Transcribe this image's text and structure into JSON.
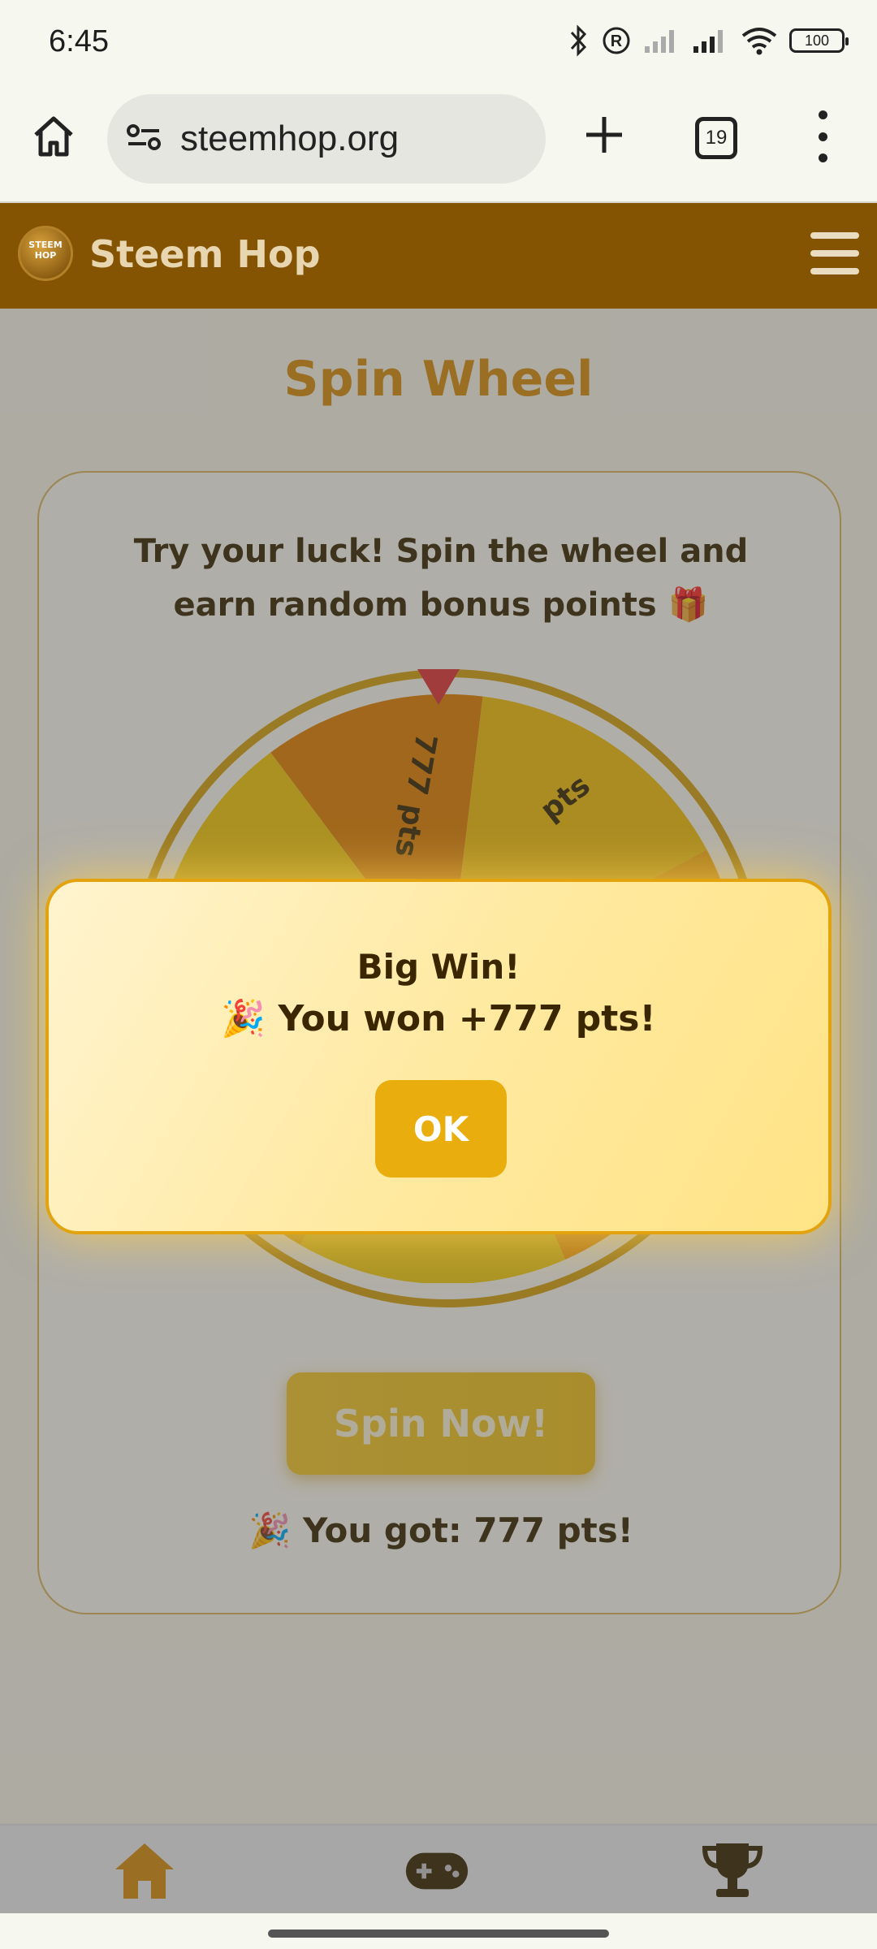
{
  "status_bar": {
    "time": "6:45",
    "battery": "100",
    "icons": [
      "bluetooth-icon",
      "registered-icon",
      "signal-icon",
      "signal-icon",
      "wifi-icon",
      "battery-icon"
    ]
  },
  "browser": {
    "url": "steemhop.org",
    "tab_count": "19",
    "icons": [
      "home-icon",
      "site-settings-icon",
      "plus-icon",
      "tabs-icon",
      "more-vert-icon"
    ]
  },
  "site": {
    "title": "Steem Hop",
    "logo_text": "STEEM HOP"
  },
  "page": {
    "title": "Spin Wheel",
    "description": "Try your luck! Spin the wheel and earn random bonus points 🎁",
    "spin_button": "Spin Now!",
    "result": "🎉 You got: 777 pts!",
    "wheel_labels": {
      "segment_top": "777 pts",
      "segment_right": "pts"
    }
  },
  "modal": {
    "title": "Big Win!",
    "message": "🎉 You won +777 pts!",
    "ok_label": "OK"
  },
  "bottom_nav": {
    "items": [
      "home-icon",
      "gamepad-icon",
      "trophy-icon"
    ]
  },
  "colors": {
    "header_bg": "#845403",
    "accent": "#d78d0d",
    "button": "#e9ad0d",
    "pointer": "#e23636"
  }
}
